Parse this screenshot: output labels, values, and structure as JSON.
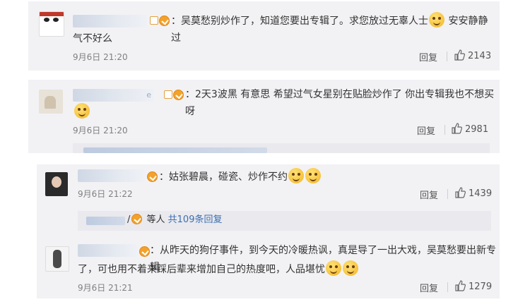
{
  "comments": [
    {
      "username": "",
      "text_line1": "：吴莫愁别炒作了，知道您要出专辑了。求您放过无辜人士",
      "text_line1b": "安安静静过",
      "text_line2": "气不好么",
      "time": "9月6日 21:20",
      "reply_label": "回复",
      "likes": "2143"
    },
    {
      "username": "e",
      "text_line1": "：2天3波黑 有意思 希望过气女星别在贴脸炒作了 你出专辑我也不想买呀",
      "time": "9月6日 21:20",
      "reply_label": "回复",
      "likes": "2981"
    },
    {
      "username": "",
      "text_line1": "：姑张碧晨，碰瓷、炒作不约",
      "time": "9月6日 21:22",
      "reply_label": "回复",
      "likes": "1439",
      "subreply": {
        "prefix": "/",
        "middle": " 等人 ",
        "link": "共109条回复"
      }
    },
    {
      "username": "",
      "text_line1": "：从昨天的狗仔事件，到今天的冷暖热讽，真是导了一出大戏，吴莫愁要出新专辑",
      "text_line2": "了，可也用不着来踩后辈来增加自己的热度吧，人品堪忧",
      "time": "9月6日 21:21",
      "reply_label": "回复",
      "likes": "1279"
    }
  ],
  "icons": {
    "like": "thumbs-up-icon",
    "verified": "verified-badge-icon",
    "emoji": "smiley-emoji-icon"
  },
  "colors": {
    "link": "#3d6fb0",
    "card": "#f2f2f5",
    "badge": "#f3a22a"
  }
}
